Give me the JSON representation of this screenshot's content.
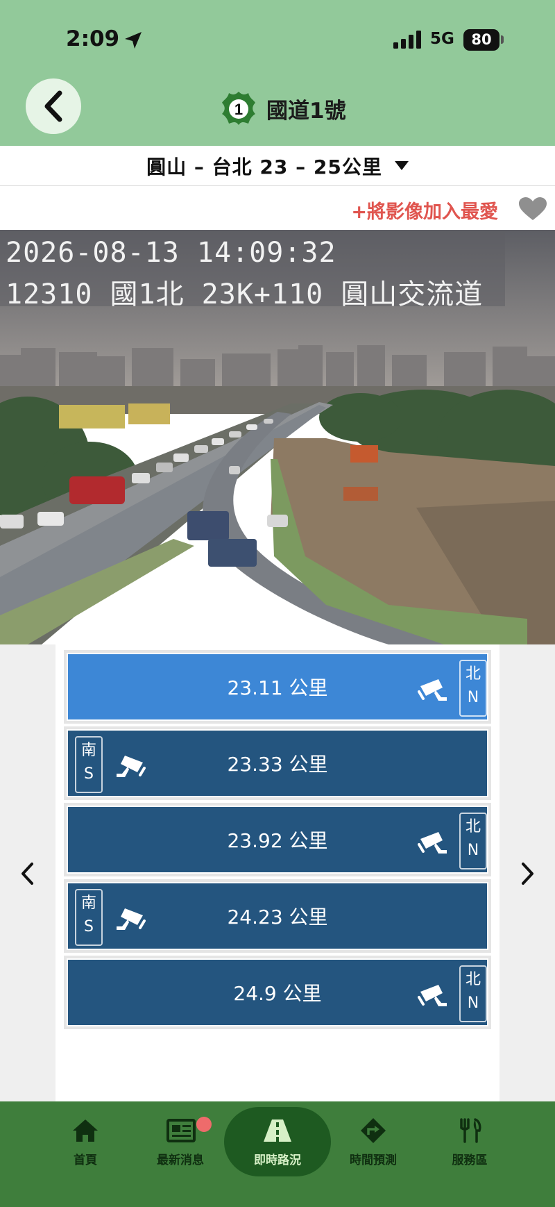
{
  "status_bar": {
    "time": "2:09",
    "network": "5G",
    "battery": "80"
  },
  "header": {
    "title": "國道1號",
    "route_number": "1"
  },
  "section": {
    "label": "圓山 – 台北 23 – 25公里"
  },
  "favorite": {
    "label": "+將影像加入最愛"
  },
  "camera": {
    "timestamp": "2026-08-13 14:09:32",
    "caption": "12310 國1北 23K+110 圓山交流道"
  },
  "cameras": [
    {
      "km": "23.11 公里",
      "dir_zh": "北",
      "dir_en": "N",
      "side": "right",
      "active": true
    },
    {
      "km": "23.33 公里",
      "dir_zh": "南",
      "dir_en": "S",
      "side": "left",
      "active": false
    },
    {
      "km": "23.92 公里",
      "dir_zh": "北",
      "dir_en": "N",
      "side": "right",
      "active": false
    },
    {
      "km": "24.23 公里",
      "dir_zh": "南",
      "dir_en": "S",
      "side": "left",
      "active": false
    },
    {
      "km": "24.9 公里",
      "dir_zh": "北",
      "dir_en": "N",
      "side": "right",
      "active": false
    }
  ],
  "nav": {
    "home": "首頁",
    "news": "最新消息",
    "live": "即時路況",
    "forecast": "時間預測",
    "service": "服務區"
  },
  "colors": {
    "header_bg": "#92c99a",
    "nav_bg": "#3f7e3c",
    "item_bg": "#24557f",
    "item_active_bg": "#3d87d6",
    "favorite": "#e0554f"
  }
}
